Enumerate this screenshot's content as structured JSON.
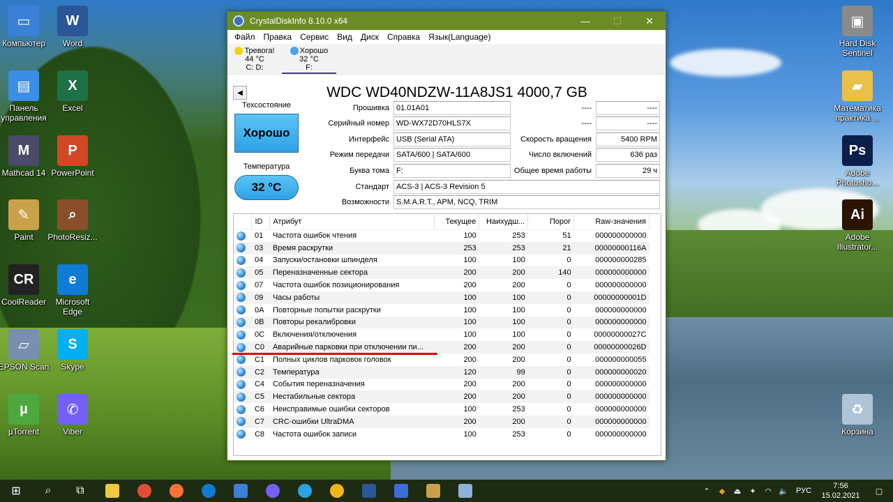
{
  "window": {
    "title": "CrystalDiskInfo 8.10.0 x64",
    "minimize": "—",
    "maximize": "☐",
    "close": "✕"
  },
  "menu": [
    "Файл",
    "Правка",
    "Сервис",
    "Вид",
    "Диск",
    "Справка",
    "Язык(Language)"
  ],
  "disks": [
    {
      "status": "Тревога!",
      "temp": "44 °C",
      "letter": "C: D:",
      "color": "#f5d400",
      "active": false
    },
    {
      "status": "Хорошо",
      "temp": "32 °C",
      "letter": "F:",
      "color": "#4aa3ee",
      "active": true
    }
  ],
  "model": "WDC WD40NDZW-11A8JS1 4000,7 GB",
  "health": {
    "caption": "Техсостояние",
    "value": "Хорошо"
  },
  "temperature": {
    "caption": "Температура",
    "value": "32 °C"
  },
  "info_left": [
    {
      "key": "Прошивка",
      "value": "01.01A01"
    },
    {
      "key": "Серийный номер",
      "value": "WD-WX72D70HLS7X"
    },
    {
      "key": "Интерфейс",
      "value": "USB (Serial ATA)"
    },
    {
      "key": "Режим передачи",
      "value": "SATA/600 | SATA/600"
    },
    {
      "key": "Буква тома",
      "value": "F:"
    },
    {
      "key": "Стандарт",
      "value": "ACS-3 | ACS-3 Revision 5"
    },
    {
      "key": "Возможности",
      "value": "S.M.A.R.T., APM, NCQ, TRIM"
    }
  ],
  "info_right": [
    {
      "key": "----",
      "value": "----"
    },
    {
      "key": "----",
      "value": "----"
    },
    {
      "key": "Скорость вращения",
      "value": "5400 RPM"
    },
    {
      "key": "Число включений",
      "value": "636 раз"
    },
    {
      "key": "Общее время работы",
      "value": "29 ч"
    }
  ],
  "smart": {
    "headers": [
      "ID",
      "Атрибут",
      "Текущее",
      "Наихудш...",
      "Порог",
      "Raw-значения"
    ],
    "rows": [
      [
        "01",
        "Частота ошибок чтения",
        "100",
        "253",
        "51",
        "000000000000"
      ],
      [
        "03",
        "Время раскрутки",
        "253",
        "253",
        "21",
        "00000000116A"
      ],
      [
        "04",
        "Запуски/остановки шпинделя",
        "100",
        "100",
        "0",
        "000000000285"
      ],
      [
        "05",
        "Переназначенные сектора",
        "200",
        "200",
        "140",
        "000000000000"
      ],
      [
        "07",
        "Частота ошибок позиционирования",
        "200",
        "200",
        "0",
        "000000000000"
      ],
      [
        "09",
        "Часы работы",
        "100",
        "100",
        "0",
        "00000000001D"
      ],
      [
        "0A",
        "Повторные попытки раскрутки",
        "100",
        "100",
        "0",
        "000000000000"
      ],
      [
        "0B",
        "Повторы рекалибровки",
        "100",
        "100",
        "0",
        "000000000000"
      ],
      [
        "0C",
        "Включения/отключения",
        "100",
        "100",
        "0",
        "00000000027C"
      ],
      [
        "C0",
        "Аварийные парковки при отключении пи...",
        "200",
        "200",
        "0",
        "00000000026D"
      ],
      [
        "C1",
        "Полных циклов парковок головок",
        "200",
        "200",
        "0",
        "000000000055"
      ],
      [
        "C2",
        "Температура",
        "120",
        "99",
        "0",
        "000000000020"
      ],
      [
        "C4",
        "События переназначения",
        "200",
        "200",
        "0",
        "000000000000"
      ],
      [
        "C5",
        "Нестабильные сектора",
        "200",
        "200",
        "0",
        "000000000000"
      ],
      [
        "C6",
        "Неисправимые ошибки секторов",
        "100",
        "253",
        "0",
        "000000000000"
      ],
      [
        "C7",
        "CRC-ошибки UltraDMA",
        "200",
        "200",
        "0",
        "000000000000"
      ],
      [
        "C8",
        "Частота ошибок записи",
        "100",
        "253",
        "0",
        "000000000000"
      ]
    ]
  },
  "desktop_icons": [
    {
      "label": "Компьютер",
      "icon": "computer-icon",
      "color": "#3b7fd6"
    },
    {
      "label": "Word",
      "icon": "word-icon",
      "color": "#2b5797"
    },
    {
      "label": "Панель управления",
      "icon": "control-panel-icon",
      "color": "#3a8ee6"
    },
    {
      "label": "Excel",
      "icon": "excel-icon",
      "color": "#1e7145"
    },
    {
      "label": "Mathcad 14",
      "icon": "mathcad-icon",
      "color": "#4a4a6a"
    },
    {
      "label": "PowerPoint",
      "icon": "powerpoint-icon",
      "color": "#d24726"
    },
    {
      "label": "Paint",
      "icon": "paint-icon",
      "color": "#c9a14a"
    },
    {
      "label": "PhotoResiz...",
      "icon": "photoresizer-icon",
      "color": "#8a4f2a"
    },
    {
      "label": "CoolReader",
      "icon": "coolreader-icon",
      "color": "#222222"
    },
    {
      "label": "Microsoft Edge",
      "icon": "edge-icon",
      "color": "#0f7bd4"
    },
    {
      "label": "EPSON Scan",
      "icon": "epson-scan-icon",
      "color": "#7a8fb0"
    },
    {
      "label": "Skype",
      "icon": "skype-icon",
      "color": "#00aff0"
    },
    {
      "label": "µTorrent",
      "icon": "utorrent-icon",
      "color": "#4fa83d"
    },
    {
      "label": "Viber",
      "icon": "viber-icon",
      "color": "#7360f2"
    },
    {
      "label": "Hard Disk Sentinel",
      "icon": "hard-disk-sentinel-icon",
      "color": "#8a8a8a"
    },
    {
      "label": "Математика практика ...",
      "icon": "folder-icon",
      "color": "#e8c04a"
    },
    {
      "label": "Adobe Photosho...",
      "icon": "photoshop-icon",
      "color": "#0b1f4a"
    },
    {
      "label": "Adobe Illustrator...",
      "icon": "illustrator-icon",
      "color": "#2b1400"
    },
    {
      "label": "Корзина",
      "icon": "recycle-bin-icon",
      "color": "#b0c4d8"
    }
  ],
  "icon_glyphs": {
    "word-icon": "W",
    "excel-icon": "X",
    "mathcad-icon": "M",
    "powerpoint-icon": "P",
    "coolreader-icon": "CR",
    "skype-icon": "S",
    "utorrent-icon": "µ",
    "viber-icon": "✆",
    "photoshop-icon": "Ps",
    "illustrator-icon": "Ai",
    "computer-icon": "▭",
    "control-panel-icon": "▤",
    "paint-icon": "✎",
    "photoresizer-icon": "⌕",
    "edge-icon": "e",
    "epson-scan-icon": "▱",
    "hard-disk-sentinel-icon": "▣",
    "folder-icon": "▰",
    "recycle-bin-icon": "♻"
  },
  "taskbar": {
    "apps": [
      {
        "icon": "start-icon",
        "color": "#ffffff"
      },
      {
        "icon": "search-icon",
        "color": "#ffffff"
      },
      {
        "icon": "task-view-icon",
        "color": "#ffffff"
      },
      {
        "icon": "file-explorer-icon",
        "color": "#f2c744"
      },
      {
        "icon": "chrome-icon",
        "color": "#e24d3b"
      },
      {
        "icon": "firefox-icon",
        "color": "#ff7139"
      },
      {
        "icon": "edge-icon",
        "color": "#0f7bd4"
      },
      {
        "icon": "mail-icon",
        "color": "#3e7fd8"
      },
      {
        "icon": "viber-icon",
        "color": "#7360f2"
      },
      {
        "icon": "telegram-icon",
        "color": "#2aa3df"
      },
      {
        "icon": "archicad-icon",
        "color": "#f2b517"
      },
      {
        "icon": "word-icon",
        "color": "#2b5797"
      },
      {
        "icon": "calculator-icon",
        "color": "#3c6ed8"
      },
      {
        "icon": "paint-icon",
        "color": "#c9a14a"
      },
      {
        "icon": "crystaldiskinfo-icon",
        "color": "#8fb0d8"
      }
    ],
    "language": "РУС",
    "time": "7:56",
    "date": "15.02.2021"
  }
}
